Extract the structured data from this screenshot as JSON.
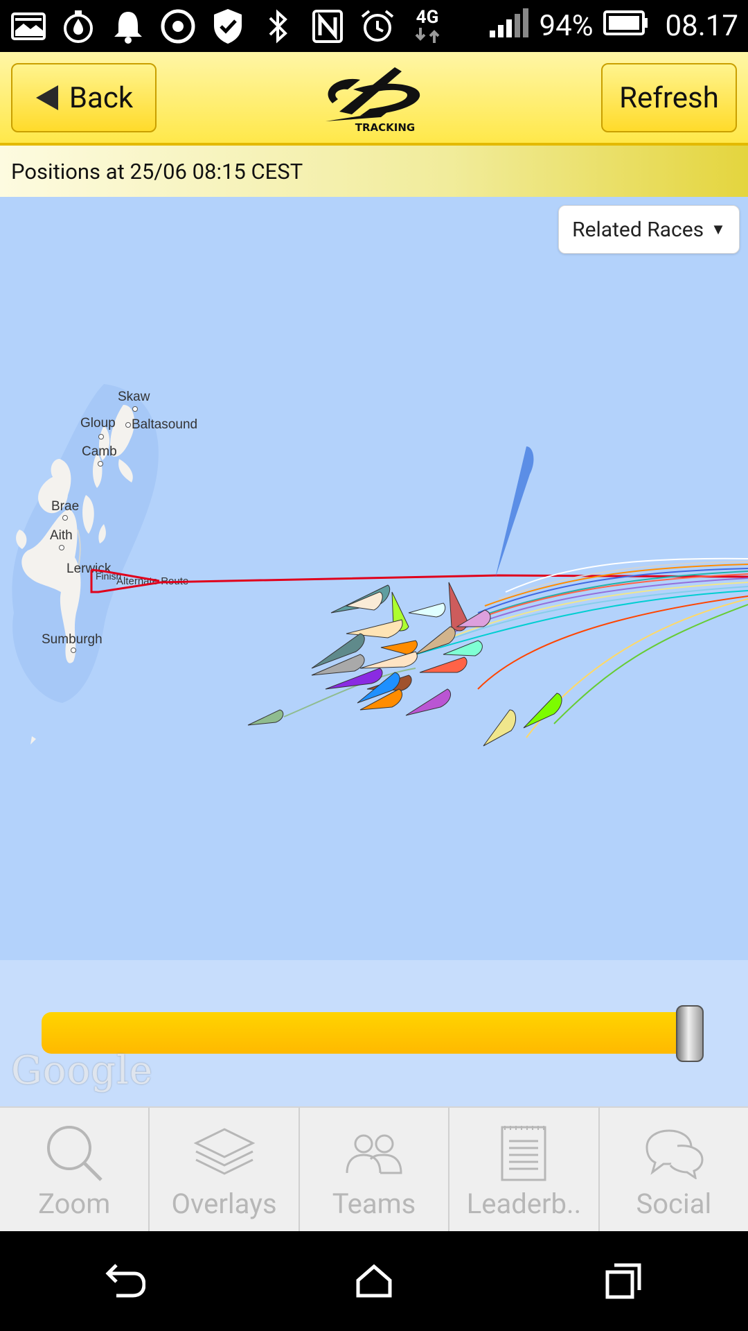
{
  "status_bar": {
    "network": "4G",
    "battery": "94%",
    "time": "08.17",
    "icons": [
      "gallery-icon",
      "water-drop-icon",
      "bell-icon",
      "record-icon",
      "shield-icon",
      "bluetooth-icon",
      "nfc-icon",
      "alarm-icon",
      "signal-icon",
      "battery-icon"
    ]
  },
  "header": {
    "back_label": "Back",
    "refresh_label": "Refresh",
    "logo_text": "TRACKING"
  },
  "info": {
    "positions_text": "Positions at 25/06 08:15 CEST"
  },
  "map": {
    "related_races_label": "Related Races",
    "related_races_arrow": "▼",
    "places": [
      "Skaw",
      "Gloup",
      "Baltasound",
      "Camb",
      "Brae",
      "Aith",
      "Lerwick",
      "Sumburgh"
    ],
    "route_label": "Alternate Route",
    "finish_label": "Finish",
    "attribution": "Google",
    "timeline_progress": 1.0,
    "colors": {
      "water": "#b3d2fb",
      "land": "#f4f2ee",
      "route": "#e0001b",
      "timeline": "#ffc800"
    }
  },
  "tabs": [
    {
      "label": "Zoom",
      "icon": "search-icon"
    },
    {
      "label": "Overlays",
      "icon": "layers-icon"
    },
    {
      "label": "Teams",
      "icon": "teams-icon"
    },
    {
      "label": "Leaderb..",
      "icon": "leaderboard-icon"
    },
    {
      "label": "Social",
      "icon": "chat-icon"
    }
  ],
  "nav": [
    "back-nav-icon",
    "home-nav-icon",
    "recents-nav-icon"
  ]
}
